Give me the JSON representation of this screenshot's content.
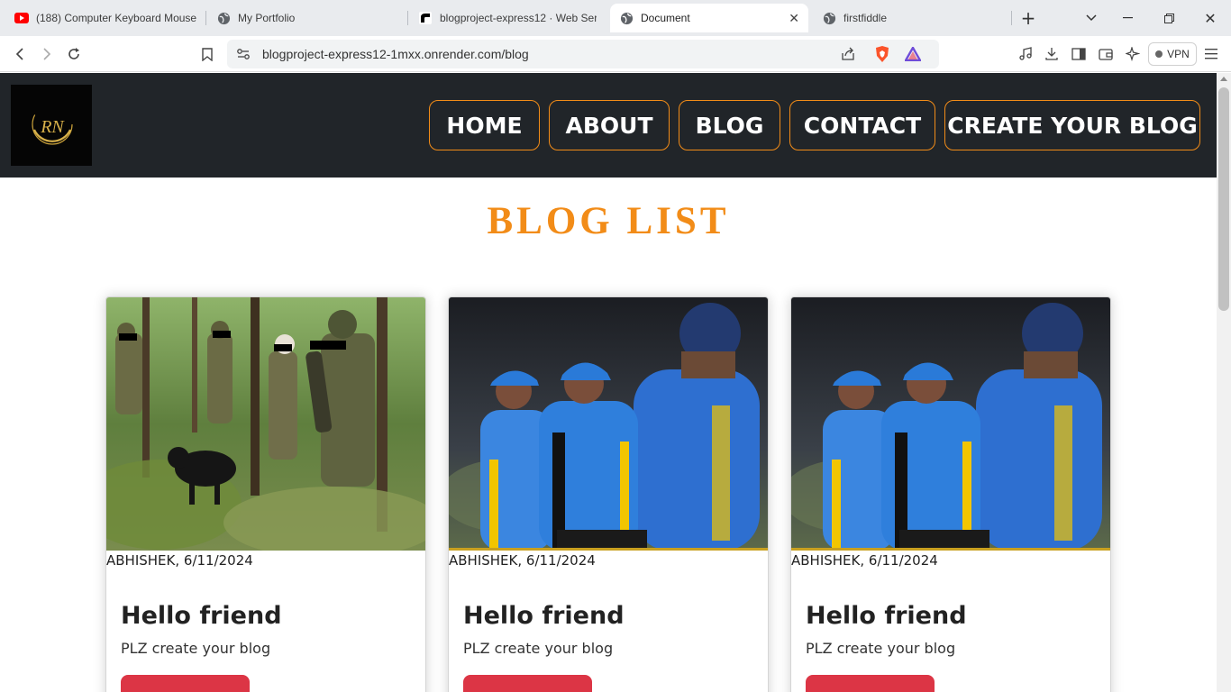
{
  "browser": {
    "tabs": [
      {
        "label": "(188) Computer Keyboard Mouse",
        "icon": "youtube-icon"
      },
      {
        "label": "My Portfolio",
        "icon": "globe-icon"
      },
      {
        "label": "blogproject-express12 · Web Ser",
        "icon": "render-icon"
      },
      {
        "label": "Document",
        "icon": "globe-icon",
        "active": true
      },
      {
        "label": "firstfiddle",
        "icon": "globe-icon"
      }
    ],
    "url": "blogproject-express12-1mxx.onrender.com/blog",
    "vpn_label": "VPN"
  },
  "site": {
    "logo_text": "RN",
    "nav": [
      "HOME",
      "ABOUT",
      "BLOG",
      "CONTACT",
      "CREATE YOUR BLOG"
    ],
    "nav_border_color": "#f28c18",
    "header_bg": "#212529",
    "title": "BLOG LIST",
    "title_color": "#f28c18"
  },
  "posts": [
    {
      "image": "soldiers-in-forest",
      "meta": "ABHISHEK, 6/11/2024",
      "title": "Hello friend",
      "desc": "PLZ create your blog"
    },
    {
      "image": "cricket-players",
      "meta": "ABHISHEK, 6/11/2024",
      "title": "Hello friend",
      "desc": "PLZ create your blog"
    },
    {
      "image": "cricket-players",
      "meta": "ABHISHEK, 6/11/2024",
      "title": "Hello friend",
      "desc": "PLZ create your blog"
    }
  ],
  "button_color": "#dc3545"
}
